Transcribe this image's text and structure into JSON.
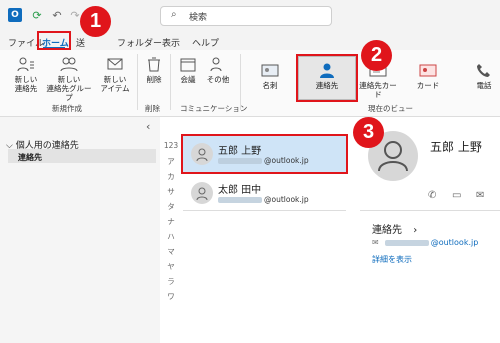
{
  "titlebar": {
    "search_text": "検索",
    "icons": [
      "outlook-icon",
      "sync-icon",
      "undo-icon",
      "redo-icon",
      "dropdown-icon"
    ]
  },
  "menu": {
    "file": "ファイル",
    "home": "ホーム",
    "send": "送",
    "folder": "フォルダー",
    "view": "表示",
    "help": "ヘルプ"
  },
  "ribbon": {
    "new_contact": [
      "新しい",
      "連絡先"
    ],
    "new_group": [
      "新しい",
      "連絡先グループ"
    ],
    "new_item": [
      "新しい",
      "アイテム"
    ],
    "group_new": "新規作成",
    "delete": "削除",
    "group_delete": "削除",
    "meeting": "会議",
    "other": "その他",
    "group_comm": "コミュニケーション",
    "view_card": "名刺",
    "view_contacts": "連絡先",
    "view_contact_card": "連絡先カード",
    "view_card2": "カード",
    "view_phone": "電話",
    "group_current_view": "現在のビュー"
  },
  "nav": {
    "root": "個人用の連絡先",
    "child": "連絡先",
    "collapse_glyph": "‹"
  },
  "index": [
    "123",
    "ア",
    "カ",
    "サ",
    "タ",
    "ナ",
    "ハ",
    "マ",
    "ヤ",
    "ラ",
    "ワ"
  ],
  "contacts": [
    {
      "name": "五郎 上野",
      "email": "@outlook.jp"
    },
    {
      "name": "太郎 田中",
      "email": "@outlook.jp"
    }
  ],
  "reading": {
    "name": "五郎 上野",
    "section": "連絡先",
    "section_chevron": "›",
    "email": "@outlook.jp",
    "detail_link": "詳細を表示"
  },
  "callouts": [
    "1",
    "2",
    "3"
  ],
  "colors": {
    "callout": "#e0151b",
    "accent": "#0f6cbd",
    "selected": "#cfe4f7"
  }
}
